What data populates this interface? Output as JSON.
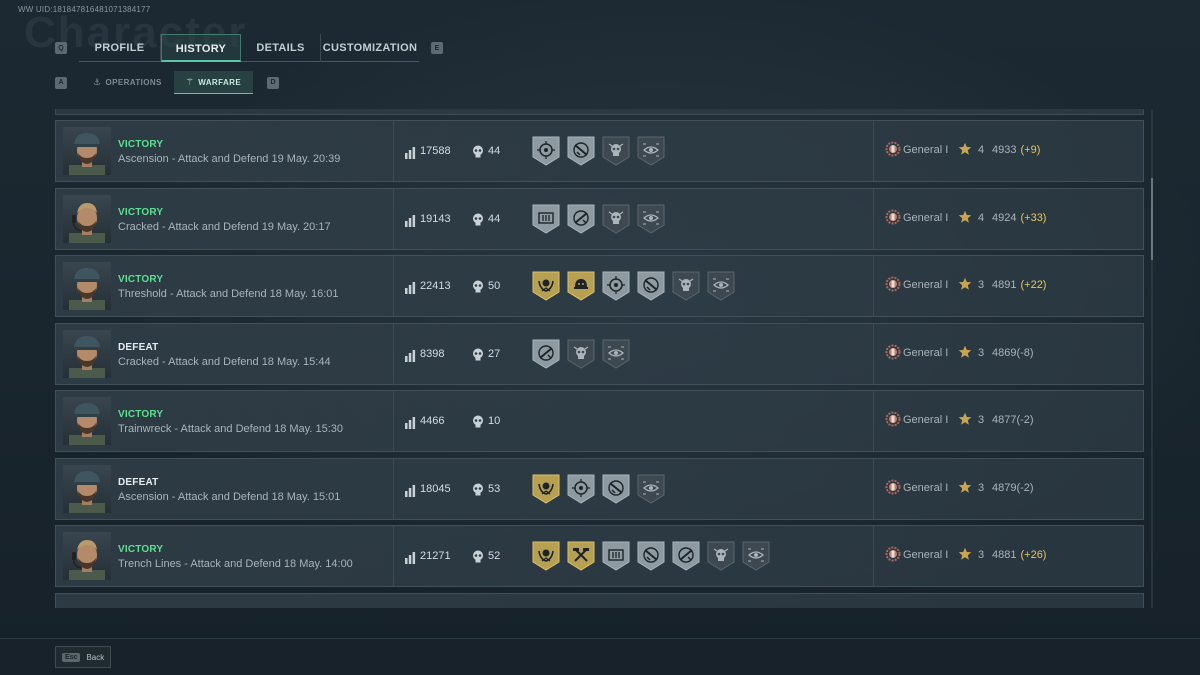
{
  "uid_text": "WW UID:18184781648107138417​7",
  "uid_display": "WW UID:181847816481071384177",
  "header_ghost": "Character",
  "tabs": {
    "left_key": "Q",
    "right_key": "E",
    "items": [
      {
        "label": "PROFILE",
        "active": false
      },
      {
        "label": "HISTORY",
        "active": true
      },
      {
        "label": "DETAILS",
        "active": false
      },
      {
        "label": "CUSTOMIZATION",
        "active": false
      }
    ]
  },
  "subtabs": {
    "left_key": "A",
    "right_key": "D",
    "items": [
      {
        "label": "OPERATIONS",
        "icon": "operations-icon",
        "active": false
      },
      {
        "label": "WARFARE",
        "icon": "warfare-icon",
        "active": true
      }
    ]
  },
  "colors": {
    "victory": "#5ce08f",
    "defeat": "#e6ecee",
    "accent": "#57c7a3",
    "gain": "#e7c65a",
    "badge_gold": "#b8a052",
    "badge_silver": "#8e9aa2",
    "badge_dark": "#3e4850"
  },
  "matches": [
    {
      "result": "VICTORY",
      "victory": true,
      "avatar": "soldier-cap",
      "description": "Ascension - Attack and Defend 19 May. 20:39",
      "score": "17588",
      "kills": "44",
      "badges": [
        {
          "kind": "crosshair",
          "tier": "silver"
        },
        {
          "kind": "rifle",
          "tier": "silver"
        },
        {
          "kind": "skull",
          "tier": "dark"
        },
        {
          "kind": "eye",
          "tier": "dark"
        }
      ],
      "rank": "General I",
      "stars": "4",
      "elo": "4933",
      "delta": "(+9)",
      "delta_positive": true
    },
    {
      "result": "VICTORY",
      "victory": true,
      "avatar": "soldier-headset",
      "description": "Cracked - Attack and Defend 19 May. 20:17",
      "score": "19143",
      "kills": "44",
      "badges": [
        {
          "kind": "ammo",
          "tier": "silver"
        },
        {
          "kind": "rifle-alt",
          "tier": "silver"
        },
        {
          "kind": "skull",
          "tier": "dark"
        },
        {
          "kind": "eye",
          "tier": "dark"
        }
      ],
      "rank": "General I",
      "stars": "4",
      "elo": "4924",
      "delta": "(+33)",
      "delta_positive": true
    },
    {
      "result": "VICTORY",
      "victory": true,
      "avatar": "soldier-cap",
      "description": "Threshold - Attack and Defend 18 May. 16:01",
      "score": "22413",
      "kills": "50",
      "badges": [
        {
          "kind": "laurel",
          "tier": "gold"
        },
        {
          "kind": "helmet",
          "tier": "gold"
        },
        {
          "kind": "crosshair",
          "tier": "silver"
        },
        {
          "kind": "rifle",
          "tier": "silver"
        },
        {
          "kind": "skull",
          "tier": "dark"
        },
        {
          "kind": "eye",
          "tier": "dark"
        }
      ],
      "rank": "General I",
      "stars": "3",
      "elo": "4891",
      "delta": "(+22)",
      "delta_positive": true
    },
    {
      "result": "DEFEAT",
      "victory": false,
      "avatar": "soldier-cap",
      "description": "Cracked - Attack and Defend 18 May. 15:44",
      "score": "8398",
      "kills": "27",
      "badges": [
        {
          "kind": "rifle-alt",
          "tier": "silver"
        },
        {
          "kind": "skull",
          "tier": "dark"
        },
        {
          "kind": "eye",
          "tier": "dark"
        }
      ],
      "rank": "General I",
      "stars": "3",
      "elo": "4869",
      "delta": "(-8)",
      "delta_positive": false
    },
    {
      "result": "VICTORY",
      "victory": true,
      "avatar": "soldier-cap",
      "description": "Trainwreck - Attack and Defend 18 May. 15:30",
      "score": "4466",
      "kills": "10",
      "badges": [],
      "rank": "General I",
      "stars": "3",
      "elo": "4877",
      "delta": "(-2)",
      "delta_positive": false
    },
    {
      "result": "DEFEAT",
      "victory": false,
      "avatar": "soldier-cap",
      "description": "Ascension - Attack and Defend 18 May. 15:01",
      "score": "18045",
      "kills": "53",
      "badges": [
        {
          "kind": "laurel",
          "tier": "gold"
        },
        {
          "kind": "crosshair",
          "tier": "silver"
        },
        {
          "kind": "rifle",
          "tier": "silver"
        },
        {
          "kind": "eye",
          "tier": "dark"
        }
      ],
      "rank": "General I",
      "stars": "3",
      "elo": "4879",
      "delta": "(-2)",
      "delta_positive": false
    },
    {
      "result": "VICTORY",
      "victory": true,
      "avatar": "soldier-headset",
      "description": "Trench Lines - Attack and Defend 18 May. 14:00",
      "score": "21271",
      "kills": "52",
      "badges": [
        {
          "kind": "laurel",
          "tier": "gold"
        },
        {
          "kind": "hammers",
          "tier": "gold"
        },
        {
          "kind": "ammo",
          "tier": "silver"
        },
        {
          "kind": "rifle",
          "tier": "silver"
        },
        {
          "kind": "rifle-alt",
          "tier": "silver"
        },
        {
          "kind": "skull",
          "tier": "dark"
        },
        {
          "kind": "eye",
          "tier": "dark"
        }
      ],
      "rank": "General I",
      "stars": "3",
      "elo": "4881",
      "delta": "(+26)",
      "delta_positive": true
    }
  ],
  "footer": {
    "key": "Esc",
    "label": "Back"
  }
}
